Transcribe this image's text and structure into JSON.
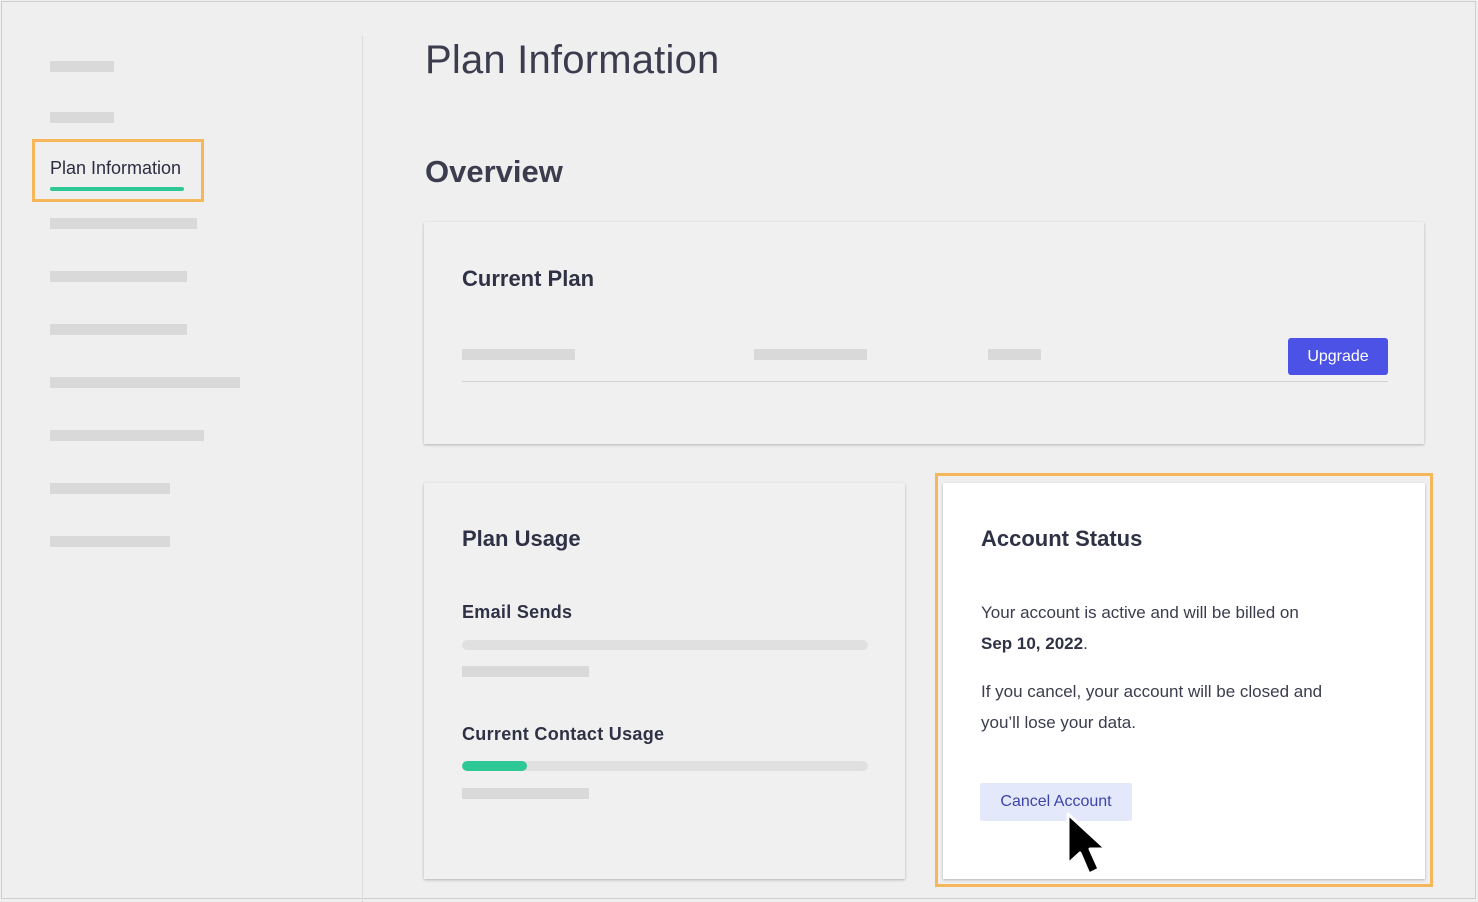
{
  "sidebar": {
    "active_item_label": "Plan Information",
    "accent_color": "#2ec796",
    "highlight_color": "#f6b75b"
  },
  "main": {
    "page_title": "Plan Information",
    "section_title": "Overview"
  },
  "current_plan": {
    "title": "Current Plan",
    "upgrade_label": "Upgrade",
    "upgrade_color": "#4d52e6"
  },
  "plan_usage": {
    "title": "Plan Usage",
    "email_sends_label": "Email Sends",
    "email_sends_progress": 0,
    "contact_usage_label": "Current Contact Usage",
    "contact_usage_progress": 0.16
  },
  "account_status": {
    "title": "Account Status",
    "billing_text": "Your account is active and will be billed on",
    "billing_date": "Sep 10, 2022",
    "billing_suffix": ".",
    "cancel_warning_line1": "If you cancel, your account will be closed and",
    "cancel_warning_line2": "you’ll lose your data.",
    "cancel_label": "Cancel Account"
  },
  "icons": {
    "cursor": "mouse-pointer-icon"
  }
}
